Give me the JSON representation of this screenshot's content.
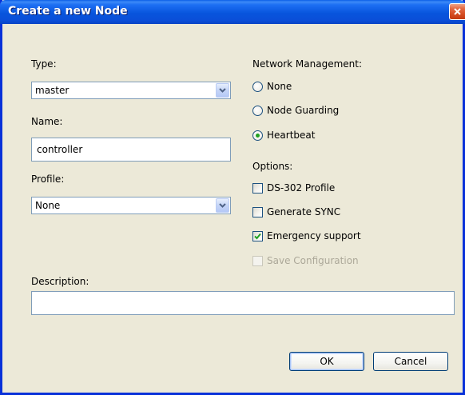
{
  "window": {
    "title": "Create a new Node"
  },
  "type": {
    "label": "Type:",
    "value": "master"
  },
  "name": {
    "label": "Name:",
    "value": "controller"
  },
  "profile": {
    "label": "Profile:",
    "value": "None"
  },
  "network_management": {
    "label": "Network Management:",
    "options": [
      {
        "label": "None",
        "selected": false
      },
      {
        "label": "Node Guarding",
        "selected": false
      },
      {
        "label": "Heartbeat",
        "selected": true
      }
    ]
  },
  "options": {
    "label": "Options:",
    "items": [
      {
        "label": "DS-302 Profile",
        "checked": false,
        "enabled": true
      },
      {
        "label": "Generate SYNC",
        "checked": false,
        "enabled": true
      },
      {
        "label": "Emergency support",
        "checked": true,
        "enabled": true
      },
      {
        "label": "Save Configuration",
        "checked": false,
        "enabled": false
      }
    ]
  },
  "description": {
    "label": "Description:",
    "value": ""
  },
  "buttons": {
    "ok": "OK",
    "cancel": "Cancel"
  },
  "colors": {
    "titlebar": "#0855dd",
    "check_mark": "#21a121",
    "dialog_bg": "#ece9d8"
  }
}
